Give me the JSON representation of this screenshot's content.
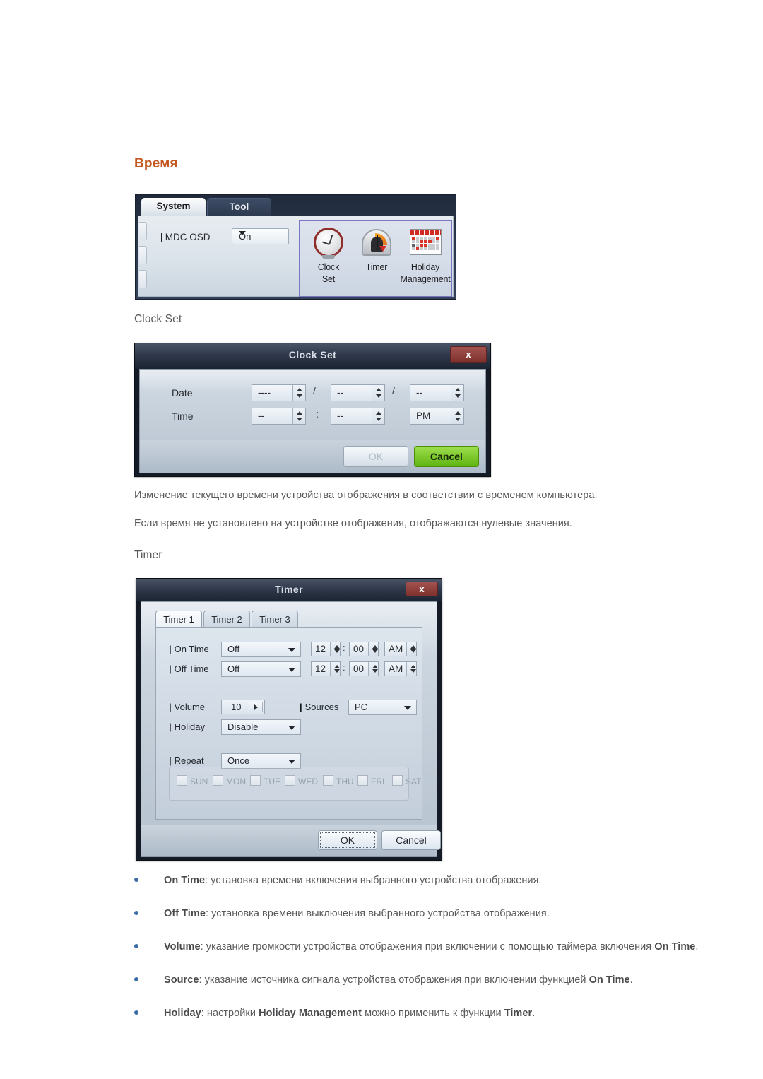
{
  "page": {
    "heading": "Время",
    "subheadings": {
      "clock_set": "Clock Set",
      "timer": "Timer"
    },
    "paragraphs": [
      "Изменение текущего времени устройства отображения в соответствии с временем компьютера.",
      "Если время не установлено на устройстве отображения, отображаются нулевые значения."
    ],
    "heading_color": "#c4571f",
    "text_color": "#58585a",
    "bullet_color": "#3b6ca8"
  },
  "ribbon": {
    "tabs": [
      {
        "label": "System",
        "active": true
      },
      {
        "label": "Tool",
        "active": false
      }
    ],
    "mdc_osd": {
      "label": "MDC OSD",
      "value": "On"
    },
    "icons": [
      {
        "name": "clock-set",
        "label_line1": "Clock",
        "label_line2": "Set"
      },
      {
        "name": "timer",
        "label_line1": "Timer",
        "label_line2": ""
      },
      {
        "name": "holiday-management",
        "label_line1": "Holiday",
        "label_line2": "Management"
      }
    ],
    "selection_color": "#7b76c4"
  },
  "clock_set_dialog": {
    "title": "Clock Set",
    "close_label": "x",
    "rows": [
      {
        "label": "Date",
        "fields": [
          {
            "value": "----"
          },
          {
            "value": "--"
          },
          {
            "value": "--"
          }
        ],
        "separators": [
          "/",
          "/"
        ]
      },
      {
        "label": "Time",
        "fields": [
          {
            "value": "--"
          },
          {
            "value": "--"
          },
          {
            "value": "PM"
          }
        ],
        "separators": [
          ":"
        ]
      }
    ],
    "buttons": {
      "ok": "OK",
      "cancel": "Cancel"
    }
  },
  "timer_dialog": {
    "title": "Timer",
    "close_label": "x",
    "tabs": [
      {
        "label": "Timer 1",
        "active": true
      },
      {
        "label": "Timer 2",
        "active": false
      },
      {
        "label": "Timer 3",
        "active": false
      }
    ],
    "on_time": {
      "label": "On Time",
      "state": "Off",
      "hour": "12",
      "minute": "00",
      "meridiem": "AM"
    },
    "off_time": {
      "label": "Off Time",
      "state": "Off",
      "hour": "12",
      "minute": "00",
      "meridiem": "AM"
    },
    "volume": {
      "label": "Volume",
      "value": "10"
    },
    "sources": {
      "label": "Sources",
      "value": "PC"
    },
    "holiday": {
      "label": "Holiday",
      "value": "Disable"
    },
    "repeat": {
      "label": "Repeat",
      "value": "Once"
    },
    "days": [
      "SUN",
      "MON",
      "TUE",
      "WED",
      "THU",
      "FRI",
      "SAT"
    ],
    "buttons": {
      "ok": "OK",
      "cancel": "Cancel"
    }
  },
  "bullets": [
    {
      "term": "On Time",
      "rest": ": установка времени включения выбранного устройства отображения."
    },
    {
      "term": "Off Time",
      "rest": ": установка времени выключения выбранного устройства отображения."
    },
    {
      "term": "Volume",
      "rest": ": указание громкости устройства отображения при включении с помощью таймера включения ",
      "term2": "On Time",
      "tail": "."
    },
    {
      "term": "Source",
      "rest": ": указание источника сигнала устройства отображения при включении функцией ",
      "term2": "On Time",
      "tail": "."
    },
    {
      "term": "Holiday",
      "rest": ": настройки ",
      "term2": "Holiday Management",
      "mid": " можно применить к функции ",
      "term3": "Timer",
      "tail": "."
    }
  ]
}
